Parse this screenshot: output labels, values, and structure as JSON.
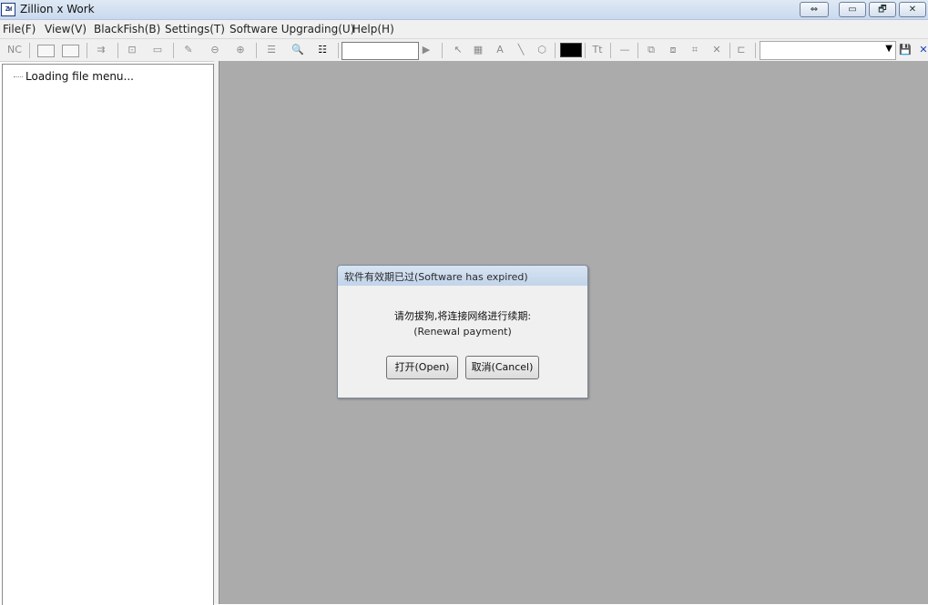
{
  "window": {
    "title": "Zillion x Work",
    "app_icon_label": "ZW",
    "buttons": [
      "⇔",
      "▭",
      "🗗",
      "✕"
    ]
  },
  "menu": {
    "items": [
      "File(F)",
      "View(V)",
      "BlackFish(B)",
      "Settings(T)",
      "Software Upgrading(U)",
      "Help(H)"
    ]
  },
  "toolbar": {
    "nc_label": "NC",
    "search_value": "",
    "text_tool_label": "Tt",
    "font_tool_label": "A",
    "color_value": "#000000",
    "combo_value": ""
  },
  "tree": {
    "loading_text": "Loading file menu..."
  },
  "dialog": {
    "title": "软件有效期已过(Software has expired)",
    "message": "请勿拔狗,将连接网络进行续期:",
    "sub_message": "(Renewal payment)",
    "open_button": "打开(Open)",
    "cancel_button": "取消(Cancel)"
  },
  "colors": {
    "workspace": "#ababab",
    "dialog_bg": "#f0f0f0",
    "titlebar": "#c9d9ee",
    "accent": "#1a3fb8"
  }
}
